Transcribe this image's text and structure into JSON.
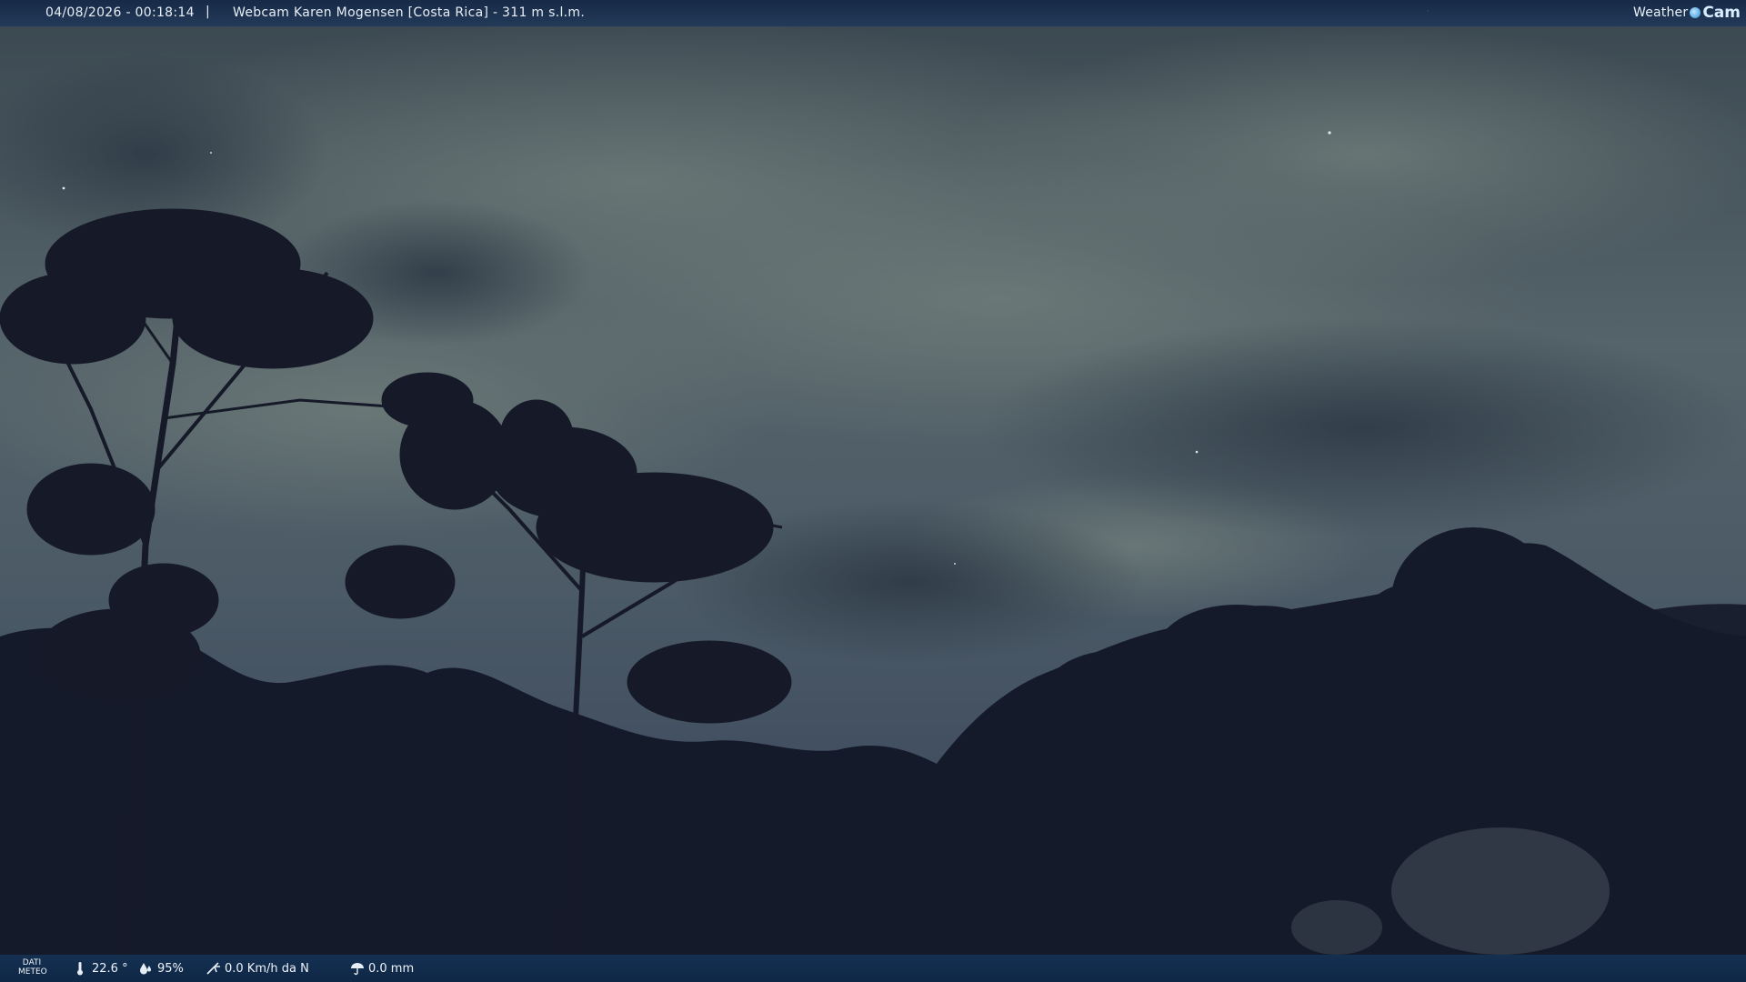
{
  "header": {
    "datetime": "04/08/2026 - 00:18:14",
    "separator": "|",
    "location": "Webcam Karen Mogensen [Costa Rica] - 311 m s.l.m.",
    "brand": {
      "weather": "Weather",
      "cam": "Cam"
    }
  },
  "footer": {
    "dati_line1": "DATI",
    "dati_line2": "METEO",
    "temperature": "22.6 °",
    "humidity": "95%",
    "wind": "0.0 Km/h da N",
    "rain": "0.0 mm",
    "icons": {
      "temperature": "thermometer-icon",
      "humidity": "humidity-icon",
      "wind": "wind-icon",
      "rain": "rain-icon"
    }
  },
  "colors": {
    "bar": "#16345a",
    "sky": "#4a5a60",
    "foliage": "#14182a",
    "text": "#eef3f9",
    "brand_accent": "#2a8fd4"
  }
}
